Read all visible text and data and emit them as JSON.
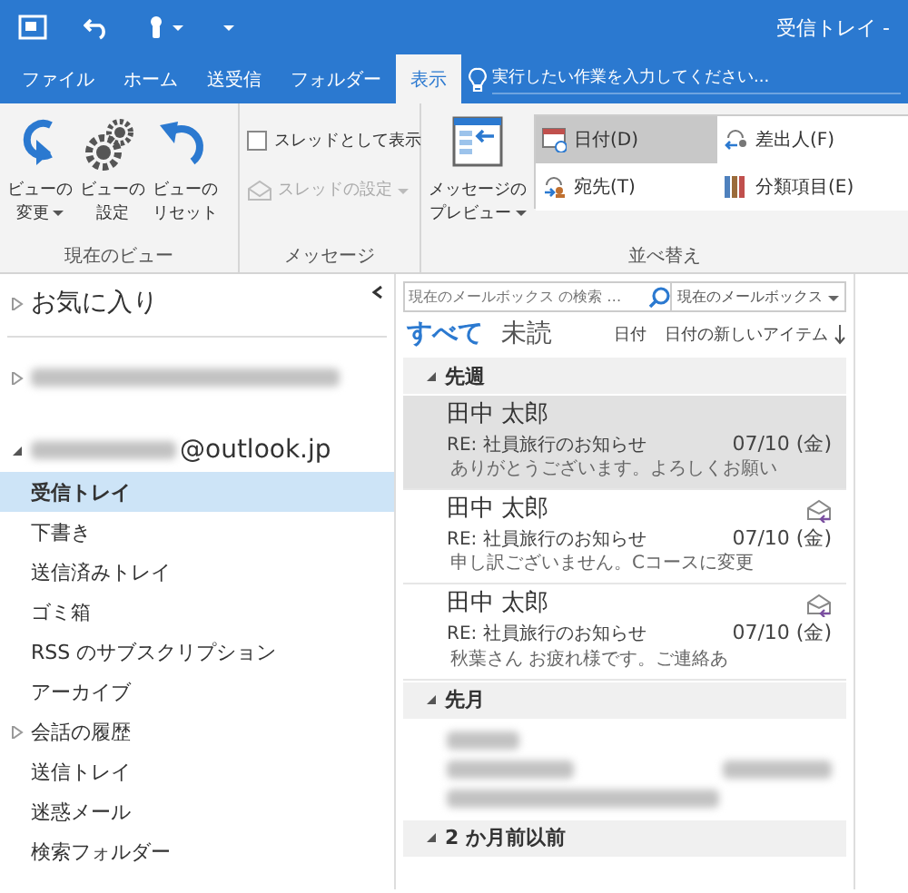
{
  "title_bar": {
    "title": "受信トレイ -"
  },
  "tabs": [
    {
      "label": "ファイル",
      "selected": false
    },
    {
      "label": "ホーム",
      "selected": false
    },
    {
      "label": "送受信",
      "selected": false
    },
    {
      "label": "フォルダー",
      "selected": false
    },
    {
      "label": "表示",
      "selected": true
    }
  ],
  "tell_me": {
    "placeholder": "実行したい作業を入力してください..."
  },
  "ribbon_groups": [
    {
      "label": "現在のビュー",
      "controls": [
        {
          "kind": "large",
          "label_lines": [
            "ビューの",
            "変更"
          ],
          "dropdown": true
        },
        {
          "kind": "large",
          "label_lines": [
            "ビューの",
            "設定"
          ],
          "dropdown": false
        },
        {
          "kind": "large",
          "label_lines": [
            "ビューの",
            "リセット"
          ],
          "dropdown": false
        }
      ]
    },
    {
      "label": "メッセージ",
      "controls": [
        {
          "kind": "checkbox",
          "label": "スレッドとして表示",
          "checked": false
        },
        {
          "kind": "small",
          "label": "スレッドの設定",
          "disabled": true,
          "dropdown": true
        }
      ]
    },
    {
      "label": "並べ替え",
      "controls": [
        {
          "kind": "large",
          "label_lines": [
            "メッセージの",
            "プレビュー"
          ],
          "dropdown": true
        },
        {
          "kind": "gallery",
          "items": [
            {
              "label": "日付(D)",
              "selected": true
            },
            {
              "label": "差出人(F)",
              "selected": false
            },
            {
              "label": "宛先(T)",
              "selected": false
            },
            {
              "label": "分類項目(E)",
              "selected": false
            }
          ]
        }
      ]
    }
  ],
  "folder_pane": {
    "favorites": {
      "label": "お気に入り",
      "expanded": false
    },
    "accounts": [
      {
        "expanded": false
      },
      {
        "address": "@outlook.jp",
        "expanded": true,
        "folders": [
          {
            "label": "受信トレイ",
            "selected": true,
            "collapsible": false
          },
          {
            "label": "下書き",
            "selected": false,
            "collapsible": false
          },
          {
            "label": "送信済みトレイ",
            "selected": false,
            "collapsible": false
          },
          {
            "label": "ゴミ箱",
            "selected": false,
            "collapsible": false
          },
          {
            "label": "RSS のサブスクリプション",
            "selected": false,
            "collapsible": false
          },
          {
            "label": "アーカイブ",
            "selected": false,
            "collapsible": false
          },
          {
            "label": "会話の履歴",
            "selected": false,
            "collapsible": true
          },
          {
            "label": "送信トレイ",
            "selected": false,
            "collapsible": false
          },
          {
            "label": "迷惑メール",
            "selected": false,
            "collapsible": false
          },
          {
            "label": "検索フォルダー",
            "selected": false,
            "collapsible": false
          }
        ]
      }
    ]
  },
  "message_list": {
    "search": {
      "placeholder": "現在のメールボックス の検索 …"
    },
    "scope": "現在のメールボックス",
    "filters": [
      {
        "label": "すべて",
        "selected": true
      },
      {
        "label": "未読",
        "selected": false
      }
    ],
    "sort": "日付",
    "order": "日付の新しいアイテム",
    "groups": [
      {
        "label": "先週",
        "messages": [
          {
            "kind": "mail",
            "sender": "田中 太郎",
            "subject": "RE: 社員旅行のお知らせ",
            "date": "07/10 (金)",
            "preview": "ありがとうございます。よろしくお願い",
            "selected": true,
            "replied": false
          },
          {
            "kind": "mail",
            "sender": "田中 太郎",
            "subject": "RE: 社員旅行のお知らせ",
            "date": "07/10 (金)",
            "preview": "申し訳ございません。Cコースに変更",
            "selected": false,
            "replied": true
          },
          {
            "kind": "mail",
            "sender": "田中 太郎",
            "subject": "RE: 社員旅行のお知らせ",
            "date": "07/10 (金)",
            "preview": "秋葉さん お疲れ様です。ご連絡あ",
            "selected": false,
            "replied": true
          }
        ]
      },
      {
        "label": "先月",
        "messages": [
          {
            "kind": "blurred"
          }
        ]
      },
      {
        "label": "2 か月前以前"
      }
    ]
  }
}
